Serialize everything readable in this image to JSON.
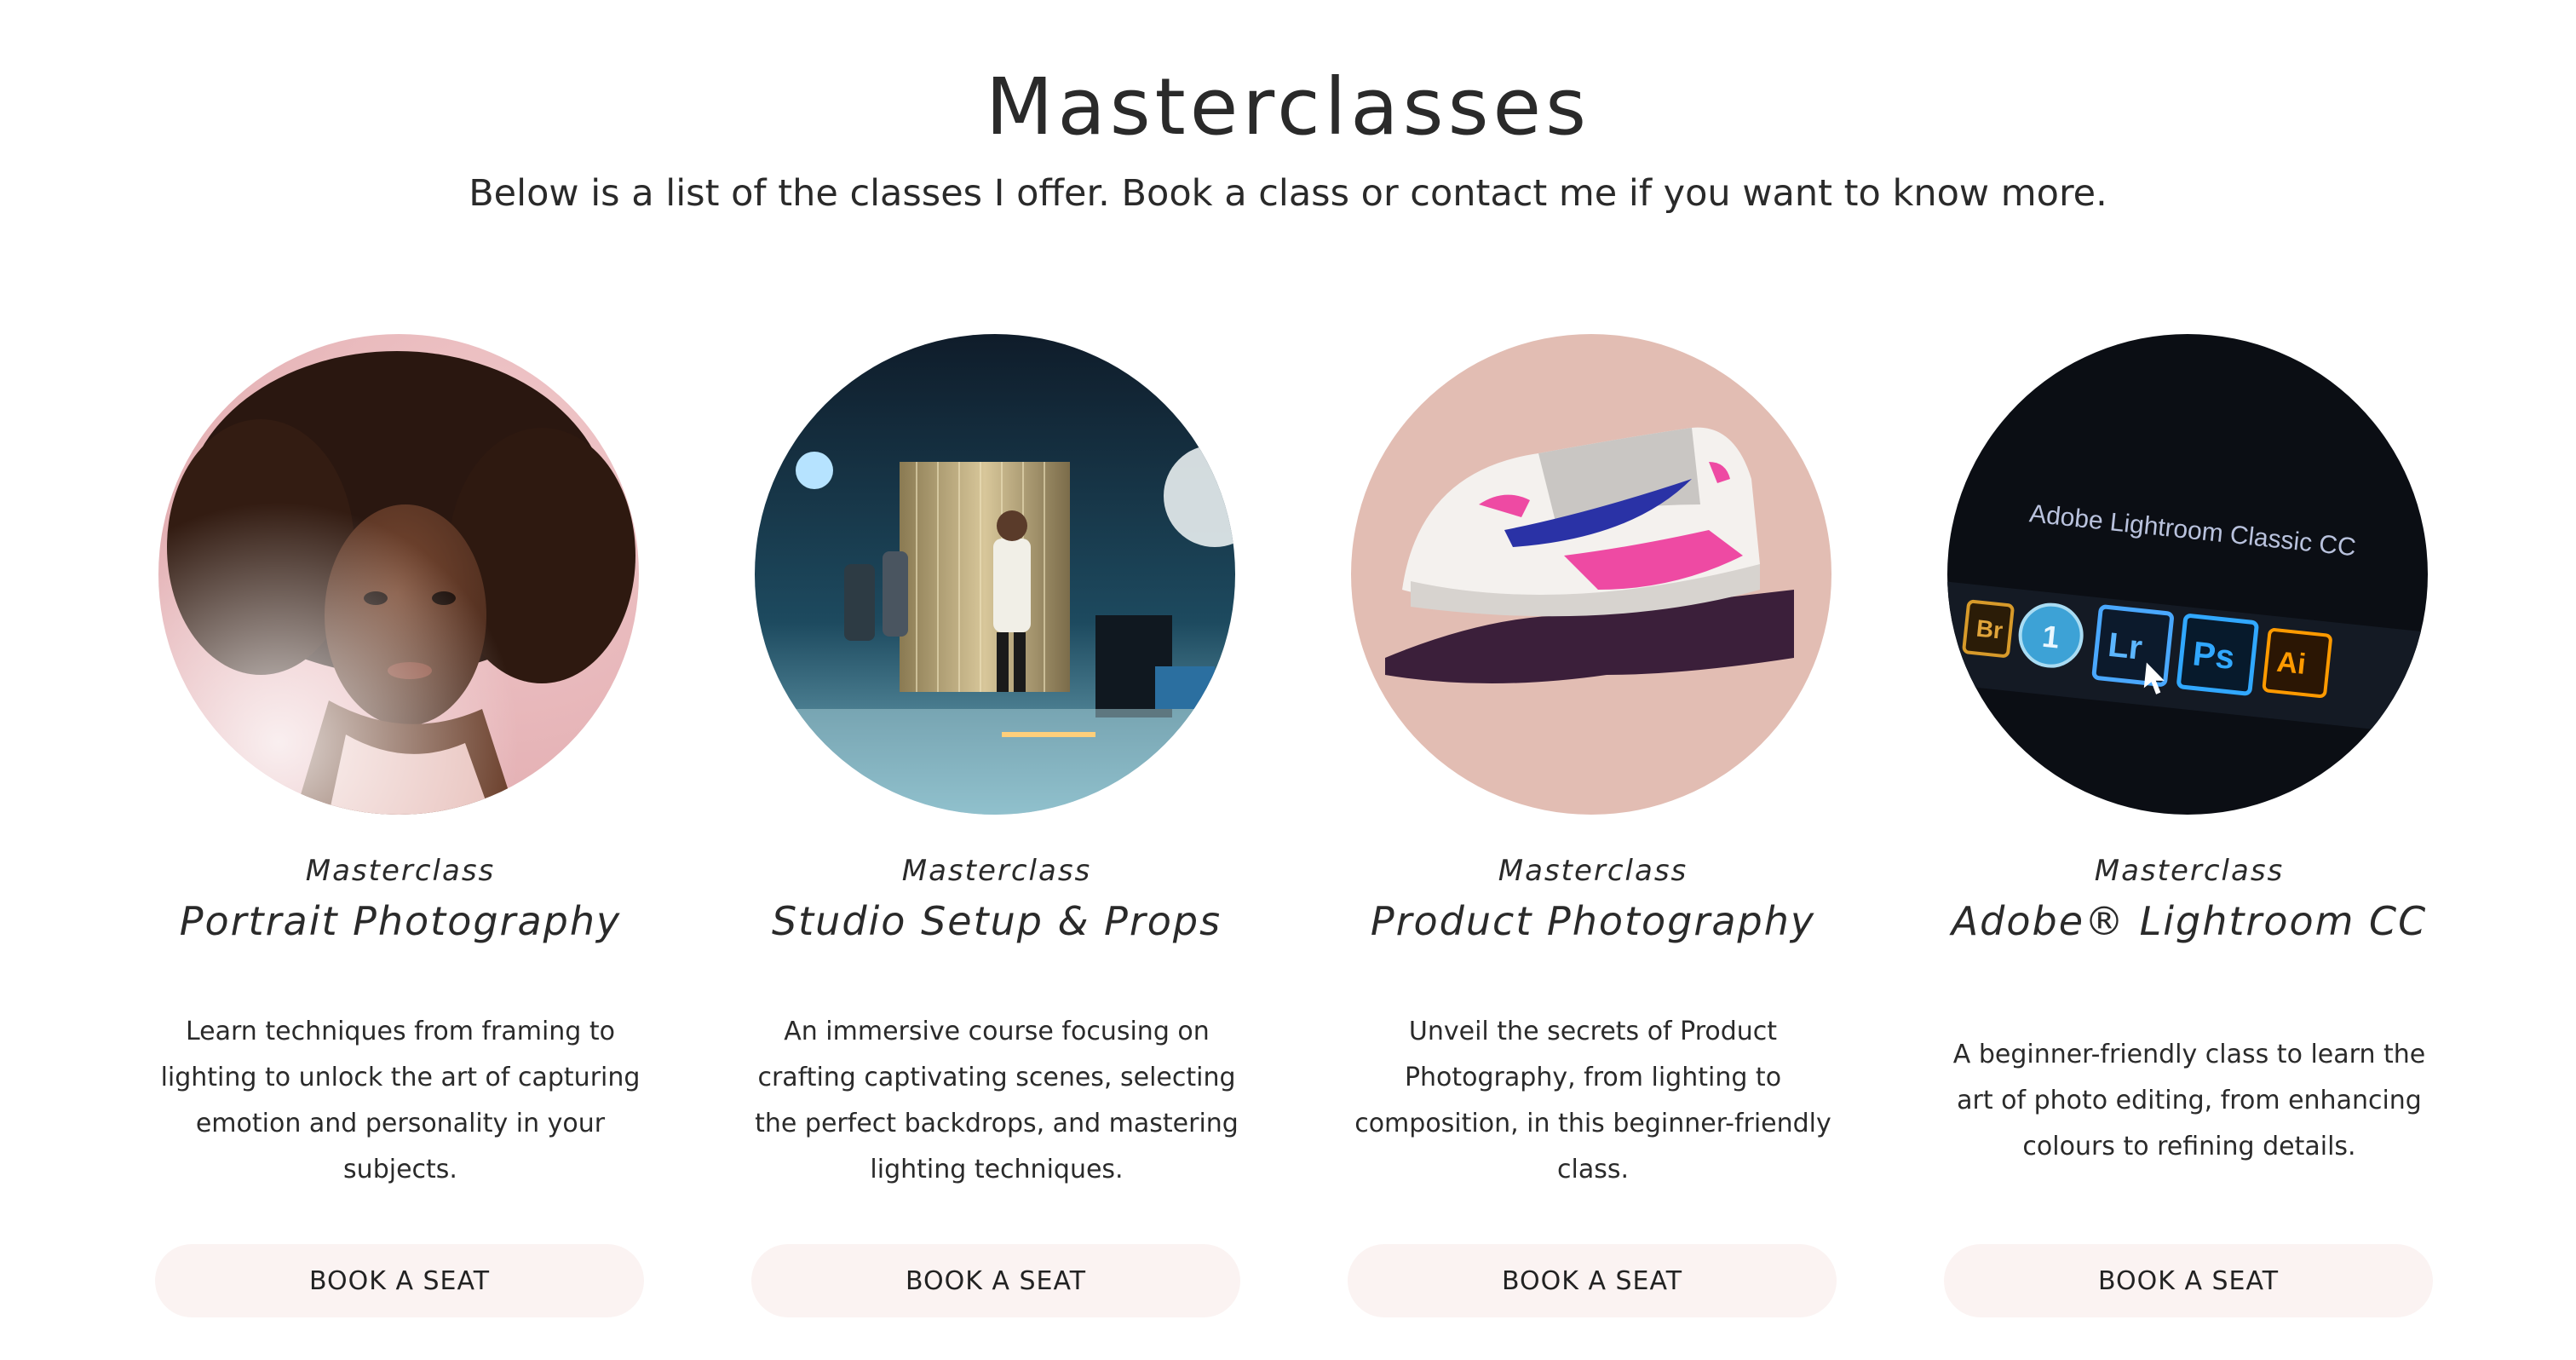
{
  "header": {
    "title": "Masterclasses",
    "subtitle": "Below is a list of the classes I offer. Book a class or contact me if you want to know more."
  },
  "cards": [
    {
      "kicker": "Masterclass",
      "title": "Portrait Photography",
      "description": "Learn techniques from framing to lighting to unlock the art of capturing emotion and personality in your subjects.",
      "cta": "BOOK A SEAT"
    },
    {
      "kicker": "Masterclass",
      "title": "Studio Setup & Props",
      "description": "An immersive course focusing on crafting captivating scenes, selecting the perfect backdrops, and mastering lighting techniques.",
      "cta": "BOOK A SEAT"
    },
    {
      "kicker": "Masterclass",
      "title": "Product Photography",
      "description": "Unveil the secrets of Product Photography, from lighting to composition, in this beginner-friendly class.",
      "cta": "BOOK A SEAT"
    },
    {
      "kicker": "Masterclass",
      "title": "Adobe® Lightroom CC",
      "description": "A beginner-friendly class to learn the art of photo editing, from enhancing colours to refining details.",
      "cta": "BOOK A SEAT"
    }
  ],
  "thumbnail_labels": {
    "lightroom_screen_text": "Adobe Lightroom Classic CC",
    "app_icons": [
      "Br",
      "1",
      "Lr",
      "Ps",
      "Ai"
    ]
  },
  "colors": {
    "button_background": "#fbf3f2",
    "text": "#2a2a2a",
    "portrait_bg": "#e8b8bb",
    "product_bg": "#e2bdb3",
    "lightroom_bg": "#0b0e14"
  }
}
